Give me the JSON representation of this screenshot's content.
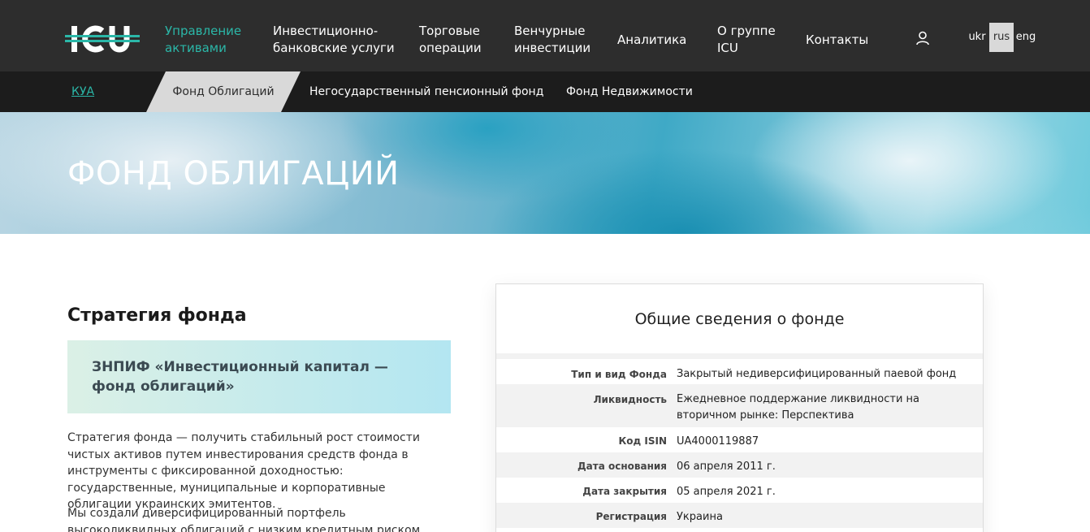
{
  "header": {
    "logo_text": "ICU",
    "nav": [
      {
        "label": "Управление\nактивами",
        "active": true
      },
      {
        "label": "Инвестиционно-\nбанковские услуги"
      },
      {
        "label": "Торговые\nоперации"
      },
      {
        "label": "Венчурные\nинвестиции"
      },
      {
        "label": "Аналитика"
      },
      {
        "label": "О группе\nICU"
      },
      {
        "label": "Контакты"
      }
    ],
    "user_icon": "user-icon",
    "languages": [
      {
        "label": "ukr"
      },
      {
        "label": "rus",
        "selected": true
      },
      {
        "label": "eng"
      }
    ]
  },
  "subnav": {
    "items": [
      {
        "label": "КУА"
      },
      {
        "label": "Фонд Облигаций",
        "active": true
      },
      {
        "label": "Негосударственный пенсионный фонд"
      },
      {
        "label": "Фонд Недвижимости"
      }
    ]
  },
  "hero": {
    "title": "ФОНД ОБЛИГАЦИЙ"
  },
  "strategy": {
    "title": "Стратегия фонда",
    "fund_name": "ЗНПИФ «Инвестиционный капитал — фонд облигаций»",
    "paragraphs": [
      "Стратегия фонда — получить стабильный рост стоимости чистых активов путем инвестирования средств фонда в инструменты с фиксированной доходностью: государственные, муниципальные и корпоративные облигации украинских эмитентов.",
      "Мы создали диверсифицированный портфель высоколиквидных облигаций с низким кредитным риском. Также наш активный"
    ]
  },
  "info": {
    "title": "Общие сведения о фонде",
    "rows": [
      {
        "label": "Тип и вид Фонда",
        "value": "Закрытый недиверсифицированный паевой фонд"
      },
      {
        "label": "Ликвидность",
        "value": "Ежедневное поддержание ликвидности на вторичном рынке: Перспектива"
      },
      {
        "label": "Код ISIN",
        "value": "UA4000119887"
      },
      {
        "label": "Дата основания",
        "value": "06 апреля 2011 г."
      },
      {
        "label": "Дата закрытия",
        "value": "05 апреля 2021 г."
      },
      {
        "label": "Регистрация",
        "value": "Украина"
      }
    ]
  },
  "colors": {
    "header_bg": "#2d2d2d",
    "subnav_bg": "#1c1c1c",
    "accent": "#2bb7a8",
    "active_tab_bg": "#d9d9d9"
  }
}
